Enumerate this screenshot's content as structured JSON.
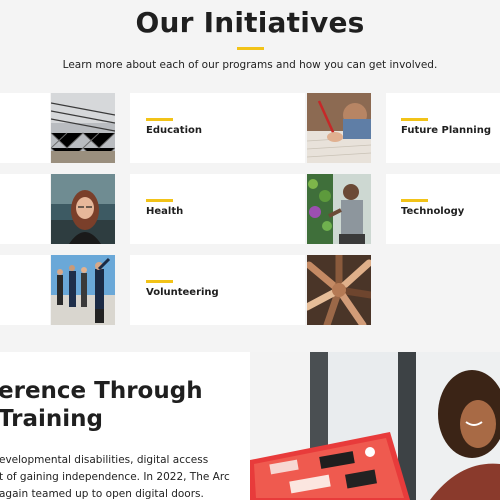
{
  "header": {
    "title": "Our Initiatives",
    "subtitle": "Learn more about each of our programs and how you can get involved."
  },
  "initiatives": [
    {
      "label": "Education",
      "image": "barbed-wire-fence-photo"
    },
    {
      "label": "Future Planning",
      "image": "student-writing-photo"
    },
    {
      "label": "Health",
      "image": "woman-with-glasses-photo"
    },
    {
      "label": "Technology",
      "image": "man-at-plant-shelf-photo"
    },
    {
      "label": "Volunteering",
      "image": "group-on-stage-photo"
    },
    {
      "label": "",
      "image": "hands-circle-photo"
    }
  ],
  "feature": {
    "heading_line1": "erence Through",
    "heading_line2": "Training",
    "body_line1": "evelopmental disabilities, digital access",
    "body_line2": "t of gaining independence. In 2022, The Arc",
    "body_line3": "again teamed up to open digital doors.",
    "image": "woman-with-laptop-photo"
  },
  "colors": {
    "accent": "#f2c318",
    "page_bg": "#f4f4f4",
    "card_bg": "#ffffff"
  }
}
